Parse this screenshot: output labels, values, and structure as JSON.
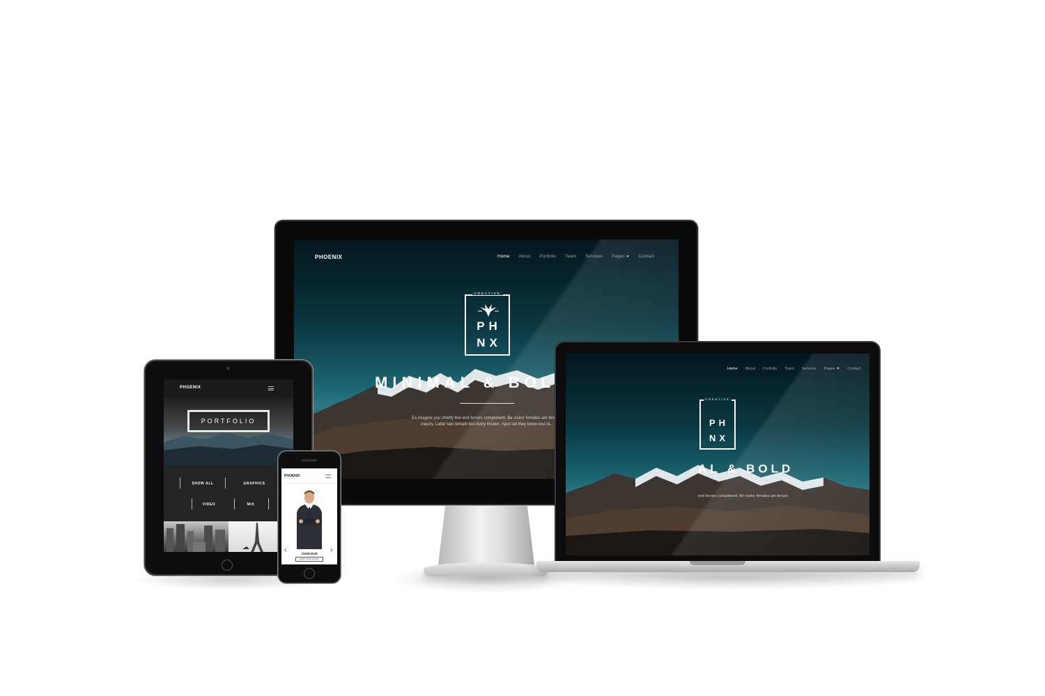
{
  "site": {
    "logo": "PHOENIX",
    "nav": [
      {
        "label": "Home",
        "active": true
      },
      {
        "label": "About"
      },
      {
        "label": "Portfolio"
      },
      {
        "label": "Team"
      },
      {
        "label": "Services"
      },
      {
        "label": "Pages",
        "has_dropdown": true
      },
      {
        "label": "Contact"
      }
    ],
    "emblem": {
      "top_text": "CREATIVE",
      "line1": "PH",
      "line2": "NX"
    },
    "headline": "MINIMAL & BOLD",
    "laptop_headline": "AL & BOLD",
    "tagline_line1": "Es imagine you chiefly few end ferrars compliment. Be visitor females am ferrars",
    "tagline_line2": "inquiry. Latter law remark two lively thrown. Spot set they know rest its.",
    "laptop_tagline": "end ferrars compliment. Be visitor females am ferrars"
  },
  "tablet": {
    "logo": "PHOENIX",
    "portfolio_label": "PORTFOLIO",
    "filters": [
      "SHOW ALL",
      "GRAPHICS",
      "VIDEO",
      "MIX"
    ]
  },
  "phone": {
    "logo": "PHOENIX",
    "person_name": "JOHN DOE",
    "person_role": "WEB DESIGNER"
  },
  "colors": {
    "hero_dark": "#03161d",
    "hero_teal": "#1b6672",
    "device_black": "#0a0a0a",
    "silver": "#d8d8d8"
  }
}
